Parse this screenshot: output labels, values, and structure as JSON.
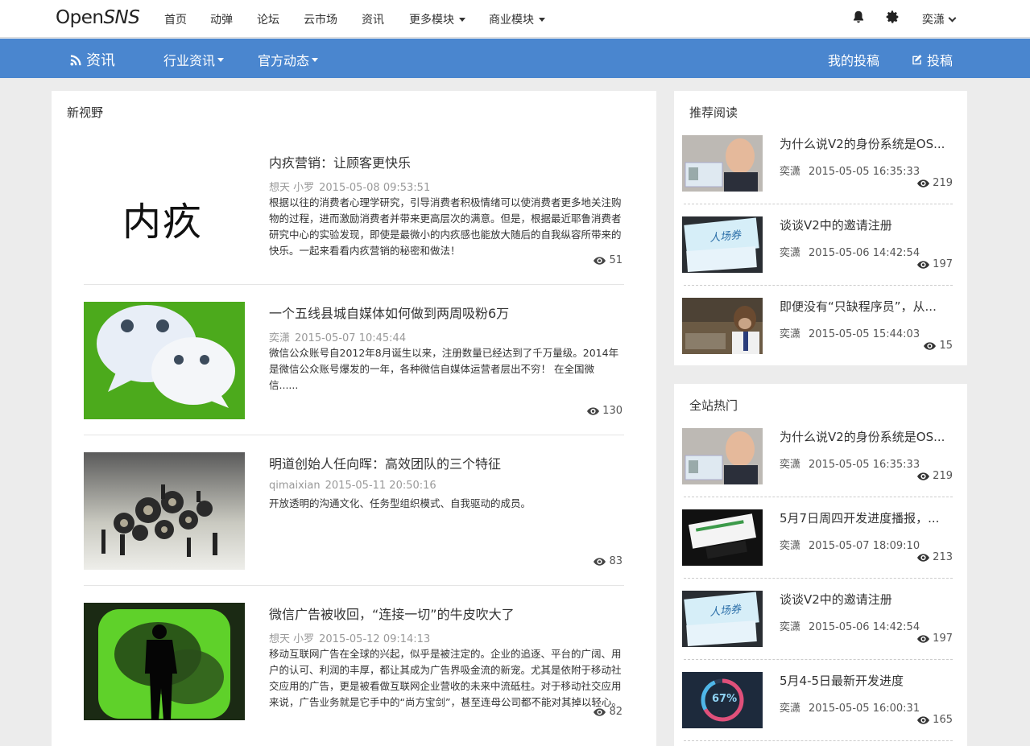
{
  "brand": {
    "logo_text": "Open",
    "logo_italic": "SNS"
  },
  "topnav": {
    "items": [
      "首页",
      "动弹",
      "论坛",
      "云市场",
      "资讯",
      "更多模块",
      "商业模块"
    ],
    "user": "奕潇"
  },
  "subnav": {
    "home": "资讯",
    "industry": "行业资讯",
    "official": "官方动态",
    "my_posts": "我的投稿",
    "post": "投稿"
  },
  "main": {
    "section_title": "新视野",
    "articles": [
      {
        "title": "内疚营销：让顾客更快乐",
        "author": "想天 小罗",
        "time": "2015-05-08 09:53:51",
        "desc": "根据以往的消费者心理学研究，引导消费者积极情绪可以使消费者更多地关注购物的过程，进而激励消费者并带来更高层次的满意。但是，根据最近耶鲁消费者研究中心的实验发现，即使是最微小的内疚感也能放大随后的自我纵容所带来的快乐。一起来看看内疚营销的秘密和做法！",
        "views": "51",
        "thumb_text": "内疚"
      },
      {
        "title": "一个五线县城自媒体如何做到两周吸粉6万",
        "author": "奕潇",
        "time": "2015-05-07 10:45:44",
        "desc": "微信公众账号自2012年8月诞生以来，注册数量已经达到了千万量级。2014年是微信公众账号爆发的一年，各种微信自媒体运营者层出不穷！ 在全国微信......",
        "views": "130"
      },
      {
        "title": "明道创始人任向晖：高效团队的三个特征",
        "author": "qimaixian",
        "time": "2015-05-11 20:50:16",
        "desc": "开放透明的沟通文化、任务型组织模式、自我驱动的成员。",
        "views": "83"
      },
      {
        "title": "微信广告被收回，“连接一切”的牛皮吹大了",
        "author": "想天 小罗",
        "time": "2015-05-12 09:14:13",
        "desc": "移动互联网广告在全球的兴起，似乎是被注定的。企业的追逐、平台的广阔、用户的认可、利润的丰厚，都让其成为广告界吸金流的新宠。尤其是依附于移动社交应用的广告，更是被看做互联网企业营收的未来中流砥柱。对于移动社交应用来说，广告业务就是它手中的“尚方宝剑”，甚至连母公司都不能对其掉以轻心。",
        "views": "82"
      }
    ]
  },
  "recommend": {
    "title": "推荐阅读",
    "items": [
      {
        "title": "为什么说V2的身份系统是OS...",
        "author": "奕潇",
        "time": "2015-05-05 16:35:33",
        "views": "219"
      },
      {
        "title": "谈谈V2中的邀请注册",
        "author": "奕潇",
        "time": "2015-05-06 14:42:54",
        "views": "197",
        "thumb_text": "人场券"
      },
      {
        "title": "即便没有“只缺程序员”，从...",
        "author": "奕潇",
        "time": "2015-05-05 15:44:03",
        "views": "15"
      }
    ]
  },
  "hot": {
    "title": "全站热门",
    "items": [
      {
        "title": "为什么说V2的身份系统是OS...",
        "author": "奕潇",
        "time": "2015-05-05 16:35:33",
        "views": "219"
      },
      {
        "title": "5月7日周四开发进度播报，...",
        "author": "奕潇",
        "time": "2015-05-07 18:09:10",
        "views": "213"
      },
      {
        "title": "谈谈V2中的邀请注册",
        "author": "奕潇",
        "time": "2015-05-06 14:42:54",
        "views": "197",
        "thumb_text": "人场券"
      },
      {
        "title": "5月4-5日最新开发进度",
        "author": "奕潇",
        "time": "2015-05-05 16:00:31",
        "views": "165",
        "thumb_text": "67%"
      }
    ]
  },
  "colors": {
    "accent": "#4a86cf",
    "wechat_green": "#4caa1c"
  },
  "icons": [
    "bell-icon",
    "gear-icon",
    "rss-icon",
    "edit-icon",
    "eye-icon"
  ]
}
